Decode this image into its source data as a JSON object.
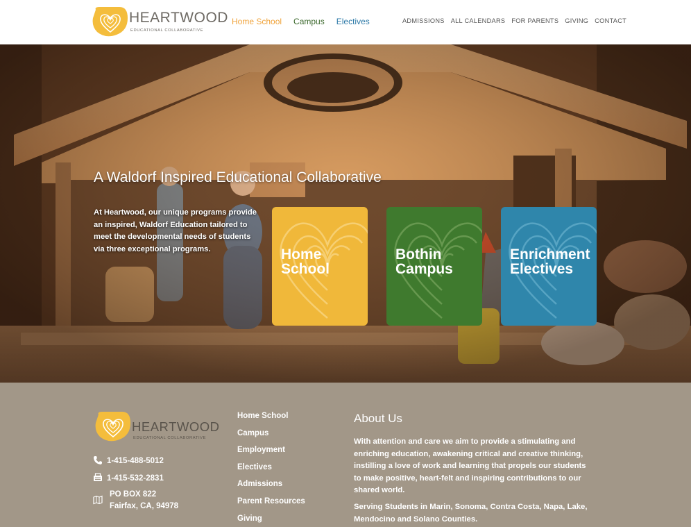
{
  "brand": {
    "name": "HEARTWOOD",
    "tagline": "EDUCATIONAL COLLABORATIVE",
    "heart_color": "#f4bd3c"
  },
  "program_nav": [
    {
      "label": "Home School",
      "color": "#f0a33a"
    },
    {
      "label": "Campus",
      "color": "#3d6a2e"
    },
    {
      "label": "Electives",
      "color": "#2d7aa8"
    }
  ],
  "utility_nav": [
    "ADMISSIONS",
    "ALL CALENDARS",
    "FOR PARENTS",
    "GIVING",
    "CONTACT"
  ],
  "hero": {
    "title": "A Waldorf Inspired Educational Collaborative",
    "text": "At Heartwood, our unique programs provide an inspired, Waldorf Education tailored to meet the developmental needs of students via three exceptional programs."
  },
  "cards": [
    {
      "line1": "Home",
      "line2": "School",
      "color": "#f0b83a"
    },
    {
      "line1": "Bothin",
      "line2": "Campus",
      "color": "#3f7a2e"
    },
    {
      "line1": "Enrichment",
      "line2": "Electives",
      "color": "#2f86ab"
    }
  ],
  "footer": {
    "bg_color": "#a29788",
    "phone": "1-415-488-5012",
    "fax": "1-415-532-2831",
    "address_line1": "PO BOX 822",
    "address_line2": "Fairfax, CA, 94978",
    "links": [
      "Home School",
      "Campus",
      "Employment",
      "Electives",
      "Admissions",
      "Parent Resources",
      "Giving"
    ],
    "about_title": "About Us",
    "about_text": "With attention and care we aim to provide a stimulating and enriching education, awakening critical and creative thinking, instilling a love of work and learning that propels our students to make positive, heart-felt and inspiring contributions to our shared world.",
    "serving_text": "Serving Students in Marin, Sonoma, Contra Costa, Napa, Lake, Mendocino and Solano Counties."
  },
  "icons": {
    "phone": "phone-icon",
    "fax": "fax-icon",
    "address": "map-icon"
  }
}
